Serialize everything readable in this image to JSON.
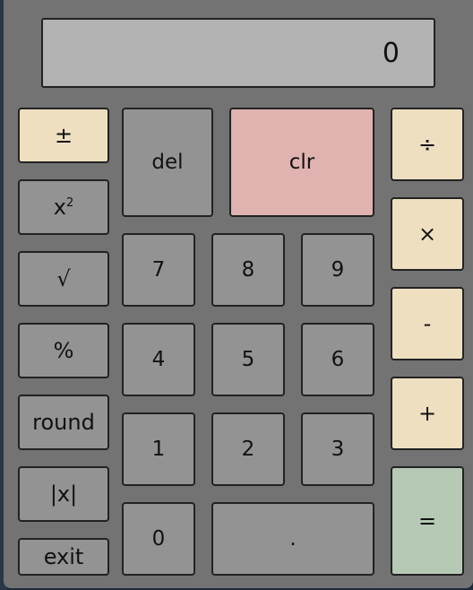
{
  "display": {
    "value": "0"
  },
  "buttons": {
    "plus_minus": "±",
    "square_base": "x",
    "square_exp": "2",
    "sqrt": "√",
    "percent": "%",
    "round": "round",
    "abs": "|x|",
    "exit": "exit",
    "del": "del",
    "clr": "clr",
    "divide": "÷",
    "multiply": "×",
    "subtract": "-",
    "add": "+",
    "equals": "=",
    "d7": "7",
    "d8": "8",
    "d9": "9",
    "d4": "4",
    "d5": "5",
    "d6": "6",
    "d1": "1",
    "d2": "2",
    "d3": "3",
    "d0": "0",
    "decimal": "."
  },
  "colors": {
    "body": "#737373",
    "display": "#b3b3b3",
    "key": "#939393",
    "function_key": "#efdfc1",
    "clear_key": "#e0b2b0",
    "equals_key": "#b5c9b5"
  }
}
